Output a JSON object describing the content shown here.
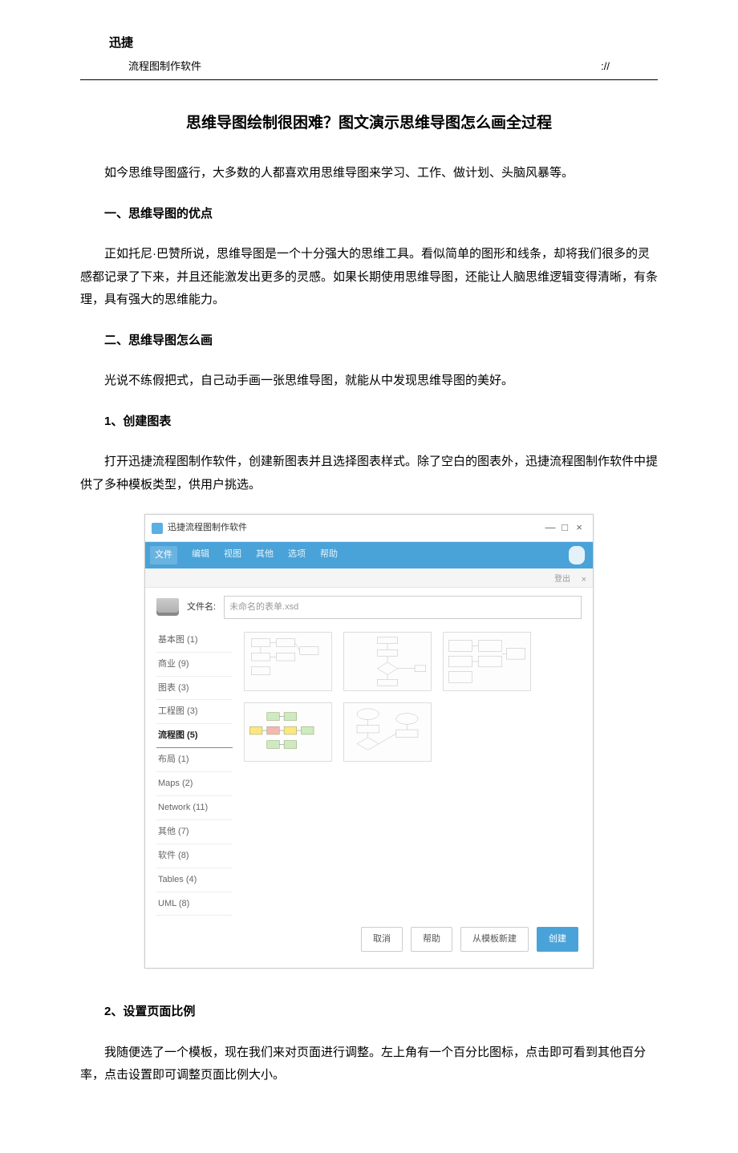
{
  "header": {
    "brand": "迅捷",
    "subtitle_left": "流程图制作软件",
    "subtitle_right": "://"
  },
  "article": {
    "title": "思维导图绘制很困难？图文演示思维导图怎么画全过程",
    "intro": "如今思维导图盛行，大多数的人都喜欢用思维导图来学习、工作、做计划、头脑风暴等。",
    "sec1_head": "一、思维导图的优点",
    "sec1_body": "正如托尼·巴赞所说，思维导图是一个十分强大的思维工具。看似简单的图形和线条，却将我们很多的灵感都记录了下来，并且还能激发出更多的灵感。如果长期使用思维导图，还能让人脑思维逻辑变得清晰，有条理，具有强大的思维能力。",
    "sec2_head": "二、思维导图怎么画",
    "sec2_body": "光说不练假把式，自己动手画一张思维导图，就能从中发现思维导图的美好。",
    "step1_head": "1、创建图表",
    "step1_body": "打开迅捷流程图制作软件，创建新图表并且选择图表样式。除了空白的图表外，迅捷流程图制作软件中提供了多种模板类型，供用户挑选。",
    "step2_head": "2、设置页面比例",
    "step2_body": "我随便选了一个模板，现在我们来对页面进行调整。左上角有一个百分比图标，点击即可看到其他百分率，点击设置即可调整页面比例大小。"
  },
  "screenshot": {
    "window_title": "迅捷流程图制作软件",
    "win_min": "—",
    "win_max": "□",
    "win_close": "×",
    "menubar": [
      "文件",
      "编辑",
      "视图",
      "其他",
      "选项",
      "帮助"
    ],
    "pill": "",
    "expand_label": "登出",
    "close_x": "×",
    "file_label": "文件名:",
    "file_value": "未命名的表单.xsd",
    "categories": [
      {
        "label": "基本图 (1)",
        "sel": false
      },
      {
        "label": "商业 (9)",
        "sel": false
      },
      {
        "label": "图表 (3)",
        "sel": false
      },
      {
        "label": "工程图 (3)",
        "sel": false
      },
      {
        "label": "流程图 (5)",
        "sel": true
      },
      {
        "label": "布局 (1)",
        "sel": false
      },
      {
        "label": "Maps (2)",
        "sel": false
      },
      {
        "label": "Network (11)",
        "sel": false
      },
      {
        "label": "其他 (7)",
        "sel": false
      },
      {
        "label": "软件 (8)",
        "sel": false
      },
      {
        "label": "Tables (4)",
        "sel": false
      },
      {
        "label": "UML (8)",
        "sel": false
      }
    ],
    "buttons": {
      "cancel": "取消",
      "import": "帮助",
      "from_template": "从模板新建",
      "create": "创建"
    }
  }
}
